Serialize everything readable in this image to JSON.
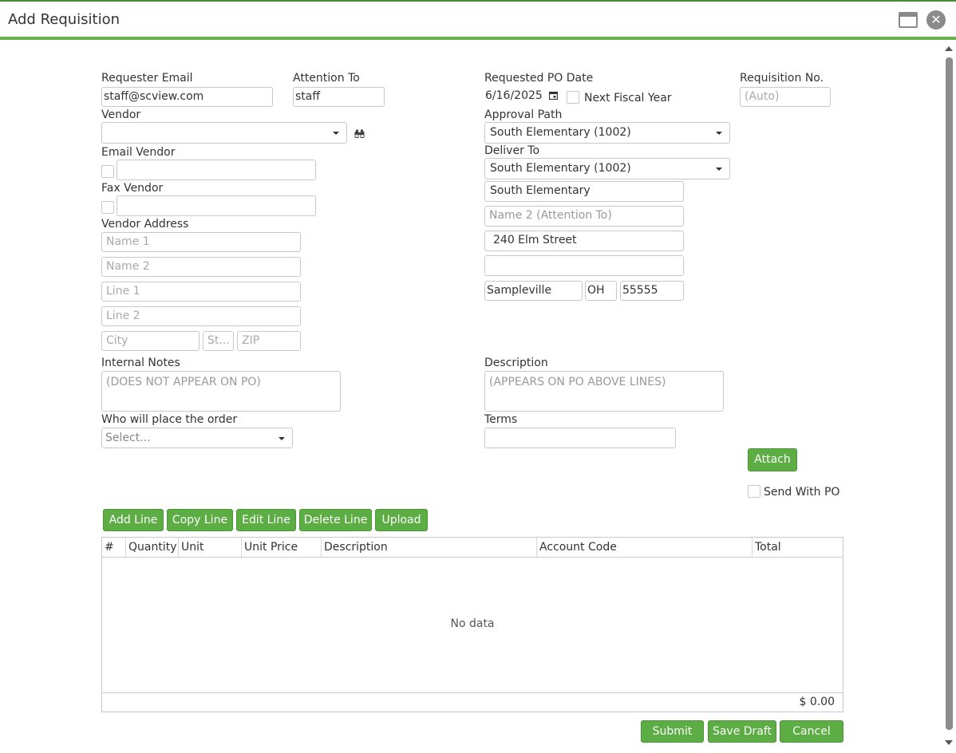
{
  "window": {
    "title": "Add Requisition"
  },
  "labels": {
    "requester_email": "Requester Email",
    "attention_to": "Attention To",
    "requested_po_date": "Requested PO Date",
    "requisition_no": "Requisition No.",
    "vendor": "Vendor",
    "approval_path": "Approval Path",
    "email_vendor": "Email Vendor",
    "deliver_to": "Deliver To",
    "fax_vendor": "Fax Vendor",
    "vendor_address": "Vendor Address",
    "internal_notes": "Internal Notes",
    "description": "Description",
    "who_will_place": "Who will place the order",
    "terms": "Terms",
    "next_fiscal_year": "Next Fiscal Year",
    "send_with_po": "Send With PO"
  },
  "values": {
    "requester_email": "staff@scview.com",
    "attention_to": "staff",
    "requested_po_date": "6/16/2025",
    "requisition_no": "(Auto)",
    "vendor": "",
    "approval_path": "South Elementary (1002)",
    "deliver_to": "South Elementary (1002)",
    "deliver_name1": "South Elementary",
    "deliver_name2": "Name 2 (Attention To)",
    "deliver_line1": "240 Elm Street",
    "deliver_line2": "",
    "deliver_city": "Sampleville",
    "deliver_state": "OH",
    "deliver_zip": "55555",
    "who_will_place": "Select...",
    "terms": ""
  },
  "placeholders": {
    "name1": "Name 1",
    "name2": "Name 2",
    "line1": "Line 1",
    "line2": "Line 2",
    "city": "City",
    "state": "St...",
    "zip": "ZIP",
    "internal_notes": "(DOES NOT APPEAR ON PO)",
    "description": "(APPEARS ON PO ABOVE LINES)"
  },
  "buttons": {
    "attach": "Attach",
    "add_line": "Add Line",
    "copy_line": "Copy Line",
    "edit_line": "Edit Line",
    "delete_line": "Delete Line",
    "upload": "Upload",
    "submit": "Submit",
    "save_draft": "Save Draft",
    "cancel": "Cancel"
  },
  "grid": {
    "columns": [
      "#",
      "Quantity",
      "Unit",
      "Unit Price",
      "Description",
      "Account Code",
      "Total"
    ],
    "empty_text": "No data",
    "total": "$ 0.00"
  },
  "colors": {
    "accent": "#5cae44",
    "titlebar_border": "#6ab04c"
  },
  "icons": {
    "vendor_lookup": "binoculars-icon",
    "date_picker": "calendar-icon"
  }
}
